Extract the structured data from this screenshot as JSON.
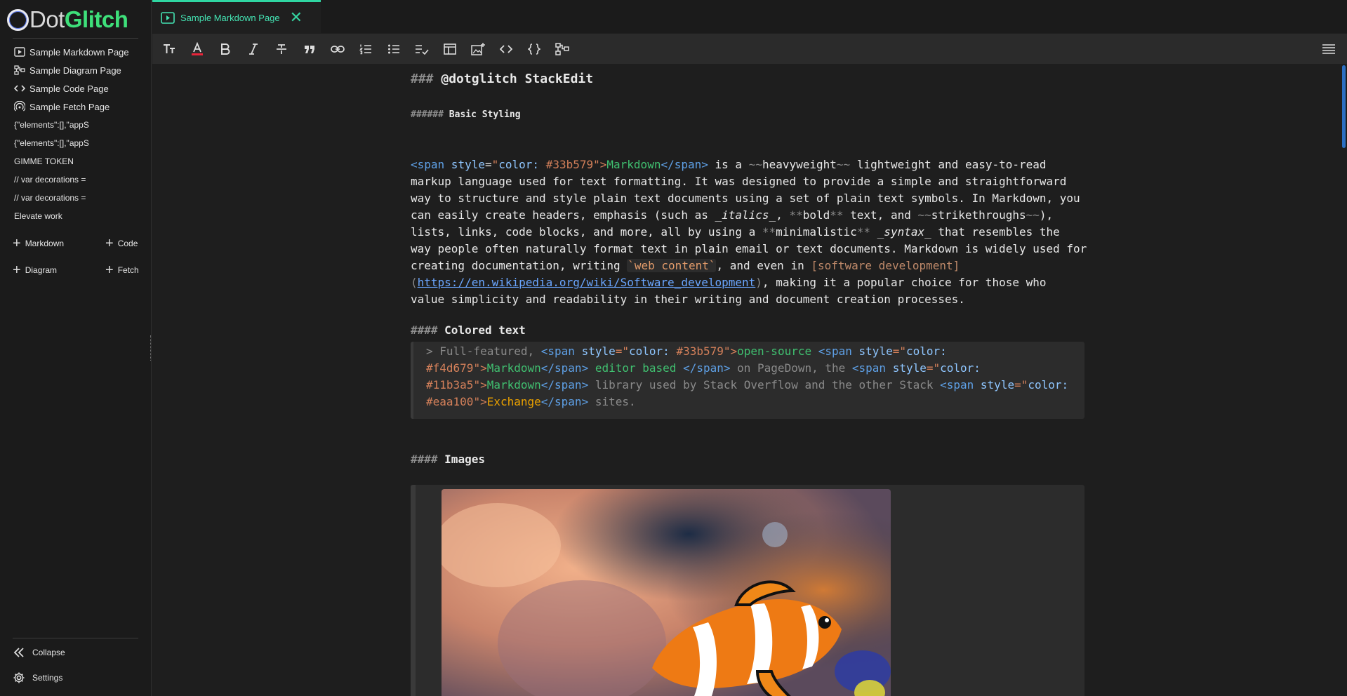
{
  "app": {
    "logo_dot": "Dot",
    "logo_glitch": "Glitch"
  },
  "sidebar": {
    "pages": [
      {
        "label": "Sample Markdown Page",
        "icon": "slides-icon"
      },
      {
        "label": "Sample Diagram Page",
        "icon": "diagram-icon"
      },
      {
        "label": "Sample Code Page",
        "icon": "code-icon"
      },
      {
        "label": "Sample Fetch Page",
        "icon": "fetch-icon"
      }
    ],
    "docs": [
      "{\"elements\":[],\"appS",
      "{\"elements\":[],\"appS",
      "GIMME TOKEN",
      "// var decorations =",
      "// var decorations =",
      "Elevate work"
    ],
    "add": {
      "markdown": "Markdown",
      "code": "Code",
      "diagram": "Diagram",
      "fetch": "Fetch"
    },
    "footer": {
      "collapse": "Collapse",
      "settings": "Settings"
    }
  },
  "tab": {
    "title": "Sample Markdown Page"
  },
  "editor": {
    "h3_hash": "###",
    "h3_text": "@dotglitch StackEdit",
    "h6_hash": "######",
    "h6_text": "Basic Styling",
    "p1": {
      "tag_open": "<span",
      "attr": " style",
      "eq": "=",
      "q1": "\"",
      "attr_color": "color: ",
      "color_val": "#33b579",
      "q2": "\">",
      "md": "Markdown",
      "tag_close": "</span>",
      "rest1": " is a ",
      "tilde1": "~~",
      "heavy": "heavyweight",
      "tilde2": "~~",
      "rest1b": " lightweight and easy-to-read",
      "l2": "markup language used for text formatting. It was designed to provide a simple and straightforward",
      "l3": "way to structure and style plain text documents using a set of plain text symbols. In Markdown, you",
      "l4a": "can easily create headers, emphasis (such as ",
      "l4_italics": "_italics_",
      "l4b": ", ",
      "l4_bold_open": "**",
      "l4_bold": "bold",
      "l4_bold_close": "**",
      "l4c": " text, and ",
      "l4_tilde1": "~~",
      "l4_strike": "strikethroughs",
      "l4_tilde2": "~~",
      "l4d": "),",
      "l5a": "lists, links, code blocks, and more, all by using a ",
      "l5_b1": "**",
      "l5_min": "minimalistic",
      "l5_b2": "**",
      "l5_sp": " ",
      "l5_syntax": "_syntax_",
      "l5b": " that resembles the",
      "l6": "way people often naturally format text in plain email or text documents. Markdown is widely used for",
      "l7a": "creating documentation, writing ",
      "l7_code": "`web content`",
      "l7b": ", and even in ",
      "l7_link": "[software development]",
      "l8_paren1": "(",
      "l8_url": "https://en.wikipedia.org/wiki/Software_development",
      "l8_paren2": ")",
      "l8b": ", making it a popular choice for those who",
      "l9": "value simplicity and readability in their writing and document creation processes."
    },
    "h4a_hash": "####",
    "h4a_text": "Colored text",
    "bq": {
      "l1_marker": "> ",
      "l1_text": "Full-featured, ",
      "l2_editor": " editor based ",
      "l2_pd": " on PageDown, the ",
      "l3_lib": " library used by Stack Overflow and the other Stack ",
      "l4_sites": " sites.",
      "c1": "#33b579",
      "c2": "#f4d679",
      "c3": "#11b3a5",
      "c4": "#eaa100",
      "w_open": "open-source ",
      "w_md": "Markdown",
      "w_ex": "Exchange"
    },
    "h4b_hash": "####",
    "h4b_text": "Images",
    "image_alt": "clownfish photo"
  },
  "colors": {
    "accent": "#2fd6a2",
    "brand_green": "#3ee07a",
    "scroll": "#2c6fc3"
  }
}
